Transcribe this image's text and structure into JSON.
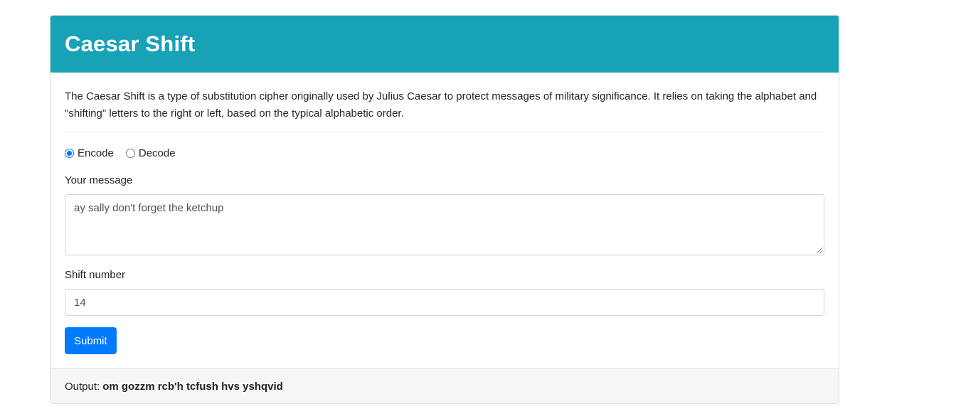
{
  "header": {
    "title": "Caesar Shift"
  },
  "intro": {
    "text": "The Caesar Shift is a type of substitution cipher originally used by Julius Caesar to protect messages of military significance. It relies on taking the alphabet and \"shifting\" letters to the right or left, based on the typical alphabetic order."
  },
  "mode": {
    "options": [
      {
        "label": "Encode",
        "checked": true
      },
      {
        "label": "Decode",
        "checked": false
      }
    ]
  },
  "message": {
    "label": "Your message",
    "value": "ay sally don't forget the ketchup"
  },
  "shift": {
    "label": "Shift number",
    "value": "14"
  },
  "submit": {
    "label": "Submit"
  },
  "output": {
    "label": "Output:",
    "value": "om gozzm rcb'h tcfush hvs yshqvid"
  },
  "colors": {
    "header_bg": "#17a2b8",
    "button_bg": "#007bff",
    "footer_bg": "#f6f6f6"
  }
}
